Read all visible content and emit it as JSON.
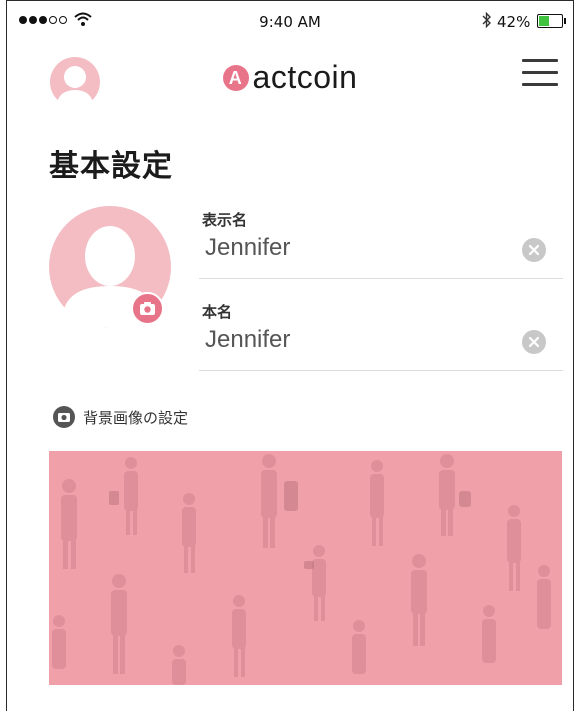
{
  "status_bar": {
    "time": "9:40 AM",
    "battery_percent": "42%",
    "battery_level": 0.42,
    "signal_bars_filled": 3,
    "signal_bars_total": 5
  },
  "header": {
    "brand_name": "actcoin",
    "brand_logo_letter": "A",
    "avatar_icon": "user-avatar-icon",
    "menu_icon": "hamburger-menu-icon"
  },
  "page": {
    "title": "基本設定"
  },
  "profile": {
    "avatar_icon": "user-silhouette-icon",
    "camera_icon": "camera-icon"
  },
  "fields": [
    {
      "label": "表示名",
      "value": "Jennifer",
      "clear_icon": "clear-icon"
    },
    {
      "label": "本名",
      "value": "Jennifer",
      "clear_icon": "clear-icon"
    }
  ],
  "background": {
    "label": "背景画像の設定",
    "camera_icon": "camera-icon"
  },
  "colors": {
    "accent": "#e8748a",
    "avatar_pink": "#f4bdc4",
    "background_image": "#f0a0a8",
    "battery_green": "#3fc23f"
  }
}
